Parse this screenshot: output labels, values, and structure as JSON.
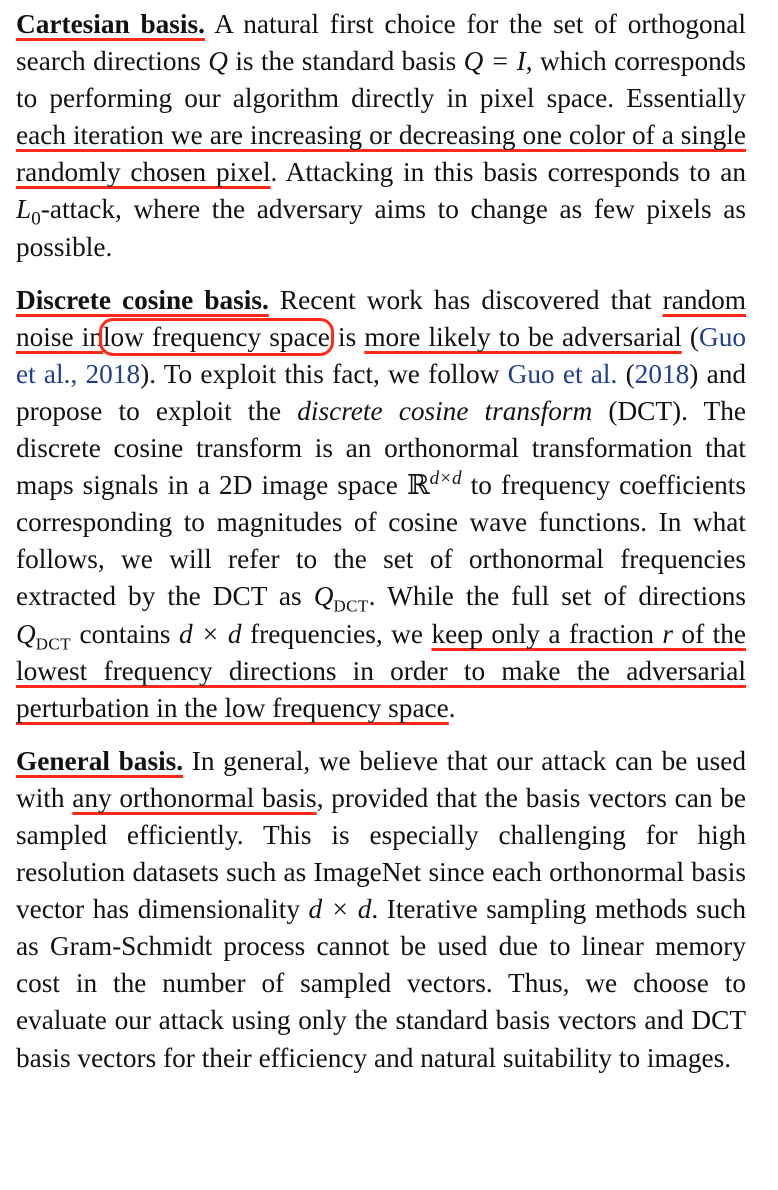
{
  "paragraphs": {
    "cartesian": {
      "heading": "Cartesian basis.",
      "t1": " A natural first choice for the set of or­thogonal search directions ",
      "t2": " is the standard basis ",
      "t3": ", which corresponds to performing our algorithm directly in pixel space. Essentially ",
      "h1": "each iteration we are increasing or decreasing one color of a single randomly chosen pixel",
      "t4": ". Attacking in this basis corresponds to an ",
      "t5": "-attack, where the adversary aims to change as few pixels as possible."
    },
    "dct": {
      "heading": "Discrete cosine basis.",
      "t1": " Recent work has discovered that ",
      "h1": "random noise in",
      "boxed": "low frequency space",
      "t2": " is ",
      "h2": "more likely to be adversarial",
      "t3": " (",
      "cite1": "Guo et al., 2018",
      "t4": "). To exploit this fact, we fol­low ",
      "cite2a": "Guo et al.",
      "t5": " (",
      "cite2b": "2018",
      "t6": ") and propose to exploit the ",
      "em1": "discrete cosine transform",
      "t7": " (DCT). The discrete cosine transform is an orthonormal transformation that maps signals in a 2D image space ",
      "t8": " to frequency coefficients corresponding to magnitudes of cosine wave functions. In what follows, we will refer to the set of orthonormal frequencies extracted by the DCT as ",
      "t9": ". While the full set of directions ",
      "t10": " contains ",
      "t11": " frequencies, we ",
      "h3": "keep only a fraction ",
      "h4": " of the lowest frequency directions in order to make the adversarial perturbation in the low frequency space",
      "t12": "."
    },
    "general": {
      "heading": "General basis.",
      "t1": " In general, we believe that our attack can be used with ",
      "h1": "any orthonormal basis",
      "t2": ", provided that the basis vectors can be sampled efficiently. This is especially chal­lenging for high resolution datasets such as ImageNet since each orthonormal basis vector has dimensionality ",
      "t3": ". Iterative sampling methods such as Gram-Schmidt process cannot be used due to linear memory cost in the number of sampled vectors. Thus, we choose to evaluate our attack using only the standard basis vectors and DCT basis vectors for their efficiency and natural suitability to images."
    }
  },
  "math": {
    "Q": "Q",
    "Q_eq_I": "Q = I",
    "L0_base": "L",
    "L0_sub": "0",
    "R_base": "ℝ",
    "R_sup": "d×d",
    "QDCT_base": "Q",
    "QDCT_sub": "DCT",
    "dxd": "d × d",
    "r": "r"
  },
  "colors": {
    "text": "#111111",
    "citation": "#1f3f8f",
    "annotation_pen": "#ff2a1a",
    "background": "#ffffff"
  }
}
